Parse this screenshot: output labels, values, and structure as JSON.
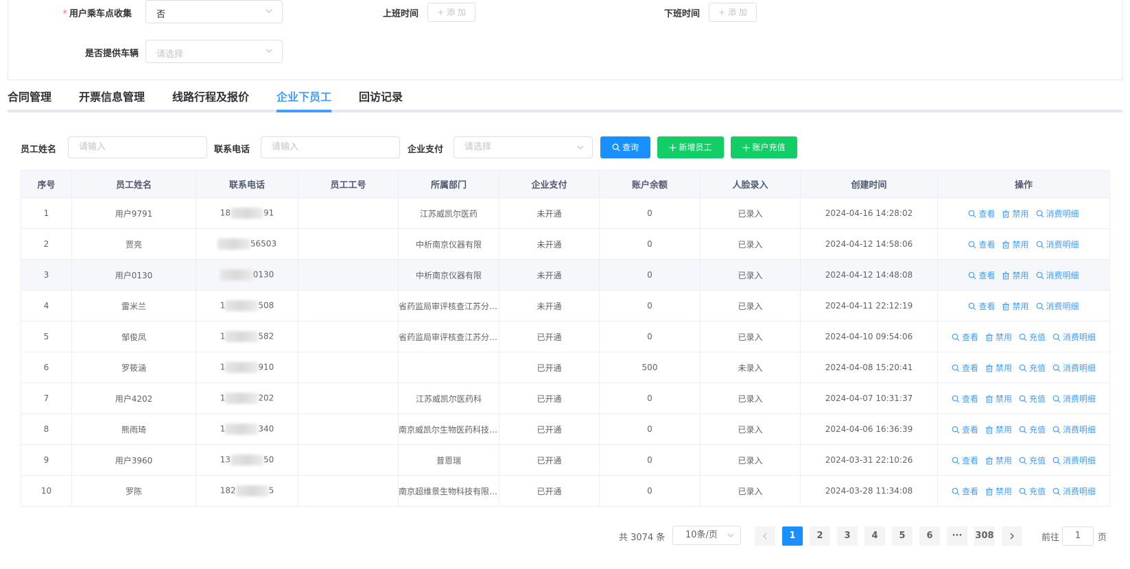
{
  "form": {
    "pickup_label": "用户乘车点收集",
    "pickup_value": "否",
    "work_start_label": "上班时间",
    "work_end_label": "下班时间",
    "add_label": "+ 添 加",
    "vehicle_label": "是否提供车辆",
    "vehicle_placeholder": "请选择"
  },
  "tabs": [
    {
      "label": "合同管理"
    },
    {
      "label": "开票信息管理"
    },
    {
      "label": "线路行程及报价"
    },
    {
      "label": "企业下员工",
      "active": true
    },
    {
      "label": "回访记录"
    }
  ],
  "search": {
    "name_label": "员工姓名",
    "name_placeholder": "请输入",
    "phone_label": "联系电话",
    "phone_placeholder": "请输入",
    "pay_label": "企业支付",
    "pay_placeholder": "请选择",
    "query_btn": "查询",
    "add_btn": "新增员工",
    "recharge_btn": "账户充值"
  },
  "table": {
    "headers": [
      "序号",
      "员工姓名",
      "联系电话",
      "员工工号",
      "所属部门",
      "企业支付",
      "账户余额",
      "人脸录入",
      "创建时间",
      "操作"
    ],
    "rows": [
      {
        "no": "1",
        "name": "用户9791",
        "phone_a": "18",
        "phone_b": "91",
        "empid": "",
        "dept": "江苏威凯尔医药",
        "pay": "未开通",
        "balance": "0",
        "face": "已录入",
        "created": "2024-04-16 14:28:02",
        "ops": [
          "查看",
          "禁用",
          "消费明细"
        ]
      },
      {
        "no": "2",
        "name": "贾亮",
        "phone_a": "",
        "phone_b": "56503",
        "empid": "",
        "dept": "中析南京仪器有限",
        "pay": "未开通",
        "balance": "0",
        "face": "已录入",
        "created": "2024-04-12 14:58:06",
        "ops": [
          "查看",
          "禁用",
          "消费明细"
        ]
      },
      {
        "no": "3",
        "name": "用户0130",
        "phone_a": "",
        "phone_b": "0130",
        "empid": "",
        "dept": "中析南京仪器有限",
        "pay": "未开通",
        "balance": "0",
        "face": "已录入",
        "created": "2024-04-12 14:48:08",
        "ops": [
          "查看",
          "禁用",
          "消费明细"
        ]
      },
      {
        "no": "4",
        "name": "雷米兰",
        "phone_a": "1",
        "phone_b": "508",
        "empid": "",
        "dept": "省药监局审评核查江苏分中心",
        "pay": "未开通",
        "balance": "0",
        "face": "已录入",
        "created": "2024-04-11 22:12:19",
        "ops": [
          "查看",
          "禁用",
          "消费明细"
        ]
      },
      {
        "no": "5",
        "name": "邹俊凤",
        "phone_a": "1",
        "phone_b": "582",
        "empid": "",
        "dept": "省药监局审评核查江苏分中心",
        "pay": "已开通",
        "balance": "0",
        "face": "已录入",
        "created": "2024-04-10 09:54:06",
        "ops": [
          "查看",
          "禁用",
          "充值",
          "消费明细"
        ]
      },
      {
        "no": "6",
        "name": "罗筱涵",
        "phone_a": "1",
        "phone_b": "910",
        "empid": "",
        "dept": "",
        "pay": "已开通",
        "balance": "500",
        "face": "未录入",
        "created": "2024-04-08 15:20:41",
        "ops": [
          "查看",
          "禁用",
          "充值",
          "消费明细"
        ]
      },
      {
        "no": "7",
        "name": "用户4202",
        "phone_a": "1",
        "phone_b": "202",
        "empid": "",
        "dept": "江苏威凯尔医药科",
        "pay": "已开通",
        "balance": "0",
        "face": "已录入",
        "created": "2024-04-07 10:31:37",
        "ops": [
          "查看",
          "禁用",
          "充值",
          "消费明细"
        ]
      },
      {
        "no": "8",
        "name": "熊雨琦",
        "phone_a": "1",
        "phone_b": "340",
        "empid": "",
        "dept": "南京威凯尔生物医药科技有限公司",
        "pay": "已开通",
        "balance": "0",
        "face": "已录入",
        "created": "2024-04-06 16:36:39",
        "ops": [
          "查看",
          "禁用",
          "充值",
          "消费明细"
        ]
      },
      {
        "no": "9",
        "name": "用户3960",
        "phone_a": "13",
        "phone_b": "50",
        "empid": "",
        "dept": "普恩瑞",
        "pay": "已开通",
        "balance": "0",
        "face": "已录入",
        "created": "2024-03-31 22:10:26",
        "ops": [
          "查看",
          "禁用",
          "充值",
          "消费明细"
        ]
      },
      {
        "no": "10",
        "name": "罗陈",
        "phone_a": "182",
        "phone_b": "5",
        "empid": "",
        "dept": "南京超维景生物科技有限公司",
        "pay": "已开通",
        "balance": "0",
        "face": "已录入",
        "created": "2024-03-28 11:34:08",
        "ops": [
          "查看",
          "禁用",
          "充值",
          "消费明细"
        ]
      }
    ]
  },
  "pagination": {
    "total": "共 3074 条",
    "page_size": "10条/页",
    "pages": [
      "1",
      "2",
      "3",
      "4",
      "5",
      "6"
    ],
    "ellipsis": "···",
    "last": "308",
    "current": "1",
    "goto_label": "前往",
    "goto_value": "1",
    "goto_unit": "页"
  },
  "colors": {
    "primary": "#1890ff",
    "success": "#13ce66",
    "link": "#409eff",
    "required": "#f56c6c"
  }
}
